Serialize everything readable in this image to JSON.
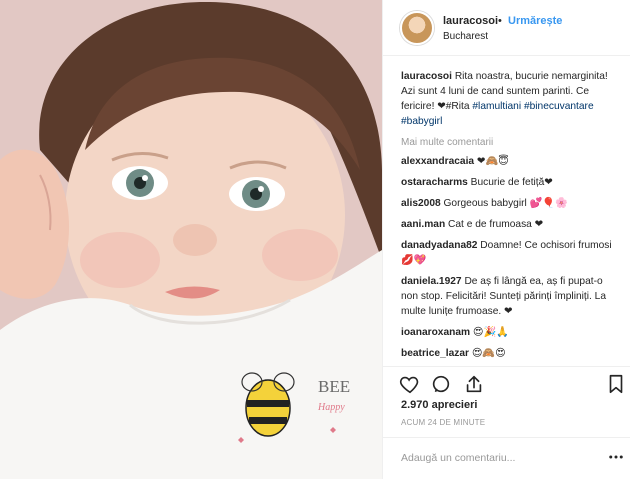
{
  "photo": {
    "print_text_top": "BEE",
    "print_text_bottom": "Happy"
  },
  "header": {
    "username": "lauracosoi",
    "dot": "•",
    "follow_label": "Urmărește",
    "location": "Bucharest"
  },
  "caption": {
    "username": "lauracosoi",
    "text": "Rita noastra, bucurie nemarginita! Azi sunt 4 luni de cand suntem parinti. Ce fericire! ❤#Rita",
    "tags": [
      "#lamultiani",
      "#binecuvantare",
      "#babygirl"
    ]
  },
  "more_comments": "Mai multe comentarii",
  "comments": [
    {
      "user": "alexxandracaia",
      "text": "❤🙈😇"
    },
    {
      "user": "ostaracharms",
      "text": "Bucurie de fetiță❤"
    },
    {
      "user": "alis2008",
      "text": "Gorgeous babygirl 💕🎈🌸"
    },
    {
      "user": "aani.man",
      "text": "Cat e de frumoasa ❤"
    },
    {
      "user": "danadyadana82",
      "text": "Doamne! Ce ochisori frumosi💋💖"
    },
    {
      "user": "daniela.1927",
      "text": "De aș fi lângă ea, aș fi pupat-o non stop. Felicitări! Sunteți părinți împliniți. La multe lunițe frumoase. ❤"
    },
    {
      "user": "ioanaroxanam",
      "text": "😍🎉🙏"
    },
    {
      "user": "beatrice_lazar",
      "text": "😍🙈😍"
    }
  ],
  "likes": "2.970 aprecieri",
  "time_ago": "ACUM 24 DE MINUTE",
  "add_comment": {
    "placeholder": "Adaugă un comentariu..."
  },
  "icons": {
    "like": "heart-outline-icon",
    "comment": "speech-bubble-icon",
    "share": "share-arrow-icon",
    "save": "bookmark-icon",
    "more": "ellipsis-icon"
  }
}
